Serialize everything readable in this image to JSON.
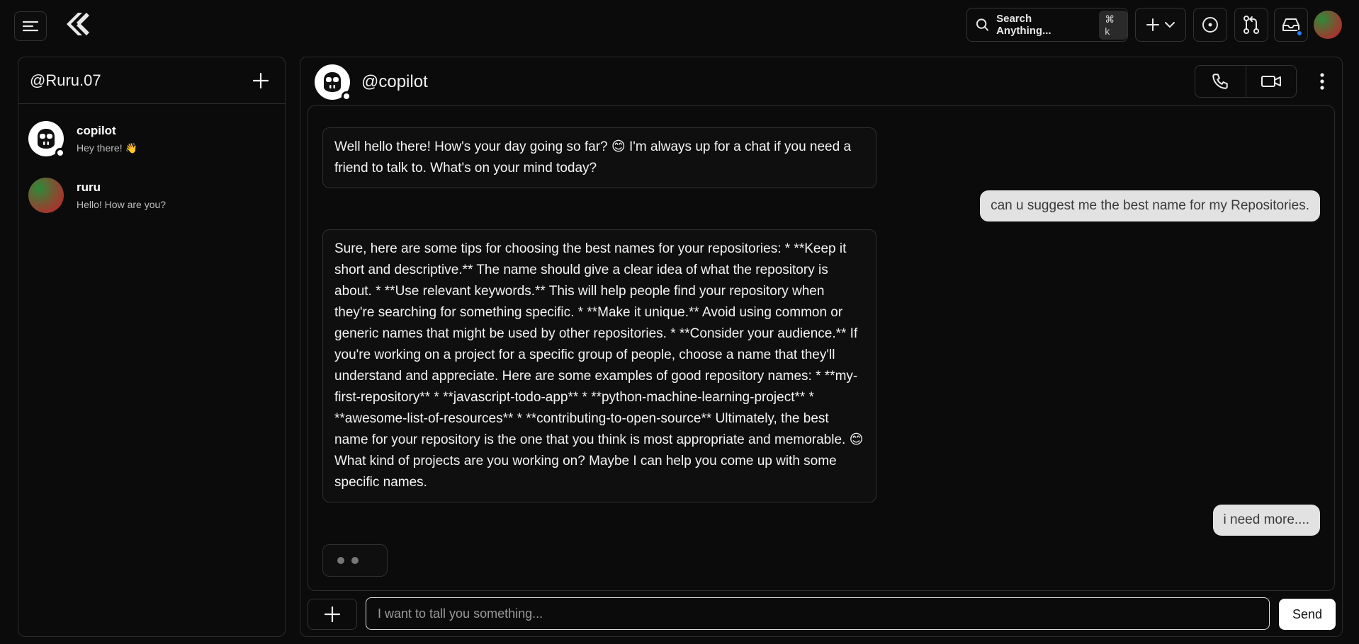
{
  "topbar": {
    "search_placeholder": "Search Anything...",
    "search_shortcut": "⌘ k",
    "icons": [
      "menu-icon",
      "app-logo",
      "search-icon",
      "plus-icon",
      "chevron-down-icon",
      "issues-icon",
      "pull-request-icon",
      "inbox-icon",
      "user-avatar"
    ]
  },
  "sidebar": {
    "title": "@Ruru.07",
    "contacts": [
      {
        "name": "copilot",
        "last_message": "Hey there! 👋"
      },
      {
        "name": "ruru",
        "last_message": "Hello! How are you?"
      }
    ]
  },
  "chat": {
    "title": "@copilot",
    "messages": [
      {
        "from": "copilot",
        "text": "Well hello there! How's your day going so far? 😊 I'm always up for a chat if you need a friend to talk to. What's on your mind today?"
      },
      {
        "from": "user",
        "text": "can u suggest me the best name for my Repositories."
      },
      {
        "from": "copilot",
        "text": "Sure, here are some tips for choosing the best names for your repositories: * **Keep it short and descriptive.** The name should give a clear idea of what the repository is about. * **Use relevant keywords.** This will help people find your repository when they're searching for something specific. * **Make it unique.** Avoid using common or generic names that might be used by other repositories. * **Consider your audience.** If you're working on a project for a specific group of people, choose a name that they'll understand and appreciate. Here are some examples of good repository names: * **my-first-repository** * **javascript-todo-app** * **python-machine-learning-project** * **awesome-list-of-resources** * **contributing-to-open-source** Ultimately, the best name for your repository is the one that you think is most appropriate and memorable. 😊 What kind of projects are you working on? Maybe I can help you come up with some specific names."
      },
      {
        "from": "user",
        "text": "i need more...."
      }
    ],
    "composer": {
      "value": "I want to tall you something...",
      "send_label": "Send"
    }
  },
  "colors": {
    "background": "#0b0b0b",
    "border": "#2c2c2c",
    "user_bubble": "#e2e2e2",
    "notification_dot": "#2f80ff"
  }
}
